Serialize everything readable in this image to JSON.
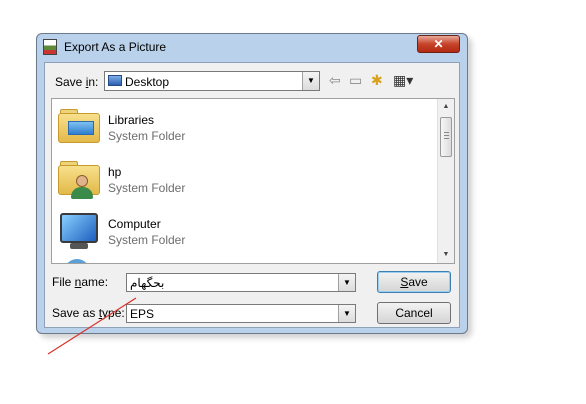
{
  "window": {
    "title": "Export As a Picture",
    "close_label": "✕"
  },
  "save_in": {
    "label_pre": "Save ",
    "label_key": "i",
    "label_post": "n:",
    "value": "Desktop"
  },
  "toolbar": {
    "back_icon": "back-arrow-icon",
    "up_icon": "up-folder-icon",
    "new_folder_icon": "new-folder-icon",
    "views_icon": "views-menu-icon"
  },
  "files": [
    {
      "name": "Libraries",
      "type": "System Folder",
      "icon": "libraries-icon"
    },
    {
      "name": "hp",
      "type": "System Folder",
      "icon": "user-folder-icon"
    },
    {
      "name": "Computer",
      "type": "System Folder",
      "icon": "computer-icon"
    }
  ],
  "file_name": {
    "label_pre": "File ",
    "label_key": "n",
    "label_post": "ame:",
    "value": "بحگهام"
  },
  "save_as_type": {
    "label_pre": "Save as ",
    "label_key": "t",
    "label_post": "ype:",
    "value": "EPS"
  },
  "buttons": {
    "save_key": "S",
    "save_rest": "ave",
    "cancel": "Cancel"
  },
  "colors": {
    "frame": "#b9d1ea",
    "close": "#c7432a",
    "annotation": "#d9322a"
  }
}
